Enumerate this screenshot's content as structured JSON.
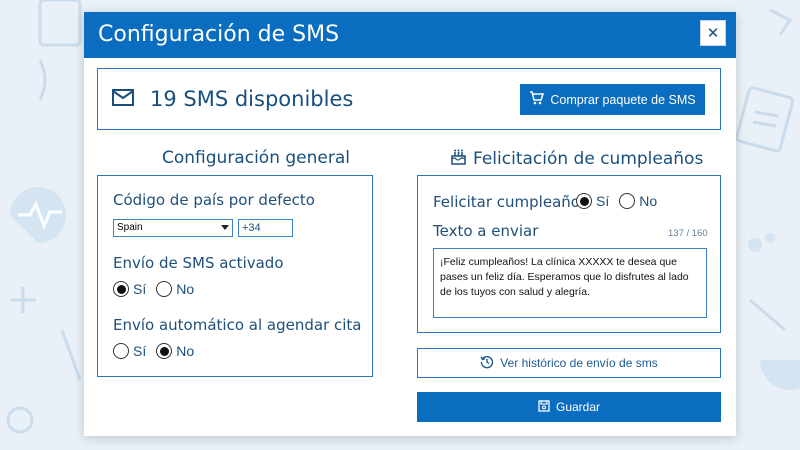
{
  "dialog": {
    "title": "Configuración de SMS",
    "close_icon": "close-icon"
  },
  "sms": {
    "icon": "envelope-icon",
    "available_text": "19 SMS disponibles",
    "buy_button_label": "Comprar paquete de SMS",
    "buy_icon": "cart-icon"
  },
  "general": {
    "title": "Configuración general",
    "country_label": "Código de país por defecto",
    "country_selected": "Spain",
    "country_prefix": "+34",
    "sms_enabled_label": "Envío de SMS activado",
    "sms_enabled": {
      "yes": "Sí",
      "no": "No",
      "selected": "yes"
    },
    "auto_send_label": "Envío automático al agendar cita",
    "auto_send": {
      "yes": "Sí",
      "no": "No",
      "selected": "no"
    }
  },
  "birthday": {
    "title": "Felicitación de cumpleaños",
    "icon": "birthday-cake-icon",
    "congratulate_label": "Felicitar cumpleaños",
    "congratulate": {
      "yes": "Sí",
      "no": "No",
      "selected": "yes"
    },
    "text_label": "Texto a enviar",
    "char_counter": "137 / 160",
    "message": "¡Feliz cumpleaños! La clínica XXXXX te desea que pases un feliz día. Esperamos que lo disfrutes al lado de los tuyos con salud y alegría."
  },
  "actions": {
    "history_label": "Ver histórico de envío de sms",
    "history_icon": "history-icon",
    "save_label": "Guardar",
    "save_icon": "save-icon"
  },
  "colors": {
    "primary": "#0a6dbf",
    "border": "#2a79c0",
    "text": "#1f4f7a",
    "background": "#e9f0f7"
  }
}
